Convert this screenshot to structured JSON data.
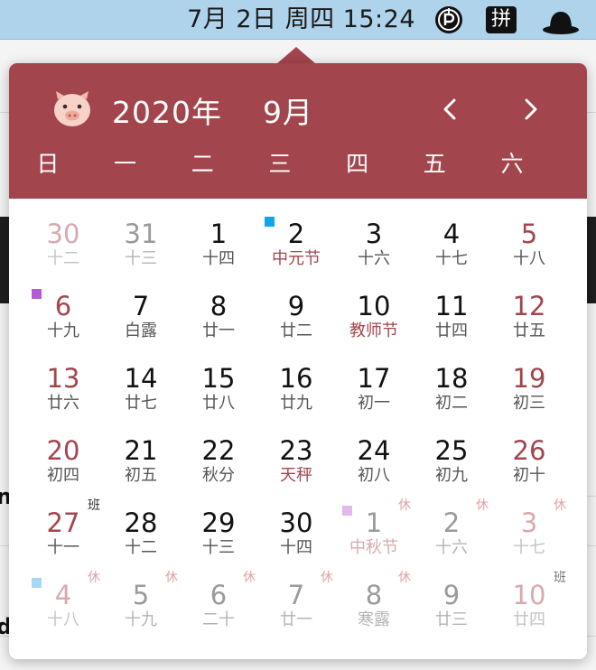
{
  "menubar": {
    "clock": "7月 2日 周四 15:24",
    "input_method_label": "拼",
    "icons": [
      "parking-icon",
      "input-method-icon",
      "hat-icon"
    ]
  },
  "background_fragments": [
    "nt",
    "d"
  ],
  "calendar": {
    "title_year": "2020年",
    "title_month": "9月",
    "icons": {
      "mascot": "pig-face-icon",
      "prev": "chevron-left-icon",
      "next": "chevron-right-icon"
    },
    "weekdays": [
      "日",
      "一",
      "二",
      "三",
      "四",
      "五",
      "六"
    ],
    "accent_color": "#a3454d",
    "days": [
      {
        "day": "30",
        "lunar": "十二",
        "muted": true,
        "weekend": true
      },
      {
        "day": "31",
        "lunar": "十三",
        "muted": true
      },
      {
        "day": "1",
        "lunar": "十四"
      },
      {
        "day": "2",
        "lunar": "中元节",
        "festival": true,
        "marker": "#0ea5e9"
      },
      {
        "day": "3",
        "lunar": "十六"
      },
      {
        "day": "4",
        "lunar": "十七"
      },
      {
        "day": "5",
        "lunar": "十八",
        "weekend": true
      },
      {
        "day": "6",
        "lunar": "十九",
        "weekend": true,
        "marker": "#b25bd6"
      },
      {
        "day": "7",
        "lunar": "白露"
      },
      {
        "day": "8",
        "lunar": "廿一"
      },
      {
        "day": "9",
        "lunar": "廿二"
      },
      {
        "day": "10",
        "lunar": "教师节",
        "festival": true
      },
      {
        "day": "11",
        "lunar": "廿四"
      },
      {
        "day": "12",
        "lunar": "廿五",
        "weekend": true
      },
      {
        "day": "13",
        "lunar": "廿六",
        "weekend": true
      },
      {
        "day": "14",
        "lunar": "廿七"
      },
      {
        "day": "15",
        "lunar": "廿八"
      },
      {
        "day": "16",
        "lunar": "廿九"
      },
      {
        "day": "17",
        "lunar": "初一"
      },
      {
        "day": "18",
        "lunar": "初二"
      },
      {
        "day": "19",
        "lunar": "初三",
        "weekend": true
      },
      {
        "day": "20",
        "lunar": "初四",
        "weekend": true
      },
      {
        "day": "21",
        "lunar": "初五"
      },
      {
        "day": "22",
        "lunar": "秋分"
      },
      {
        "day": "23",
        "lunar": "天秤",
        "festival": true
      },
      {
        "day": "24",
        "lunar": "初八"
      },
      {
        "day": "25",
        "lunar": "初九"
      },
      {
        "day": "26",
        "lunar": "初十",
        "weekend": true
      },
      {
        "day": "27",
        "lunar": "十一",
        "weekend": true,
        "badge": "班",
        "badge_type": "work"
      },
      {
        "day": "28",
        "lunar": "十二"
      },
      {
        "day": "29",
        "lunar": "十三"
      },
      {
        "day": "30",
        "lunar": "十四"
      },
      {
        "day": "1",
        "lunar": "中秋节",
        "muted": true,
        "festival": true,
        "badge": "休",
        "badge_type": "rest",
        "marker": "#e3b8ea"
      },
      {
        "day": "2",
        "lunar": "十六",
        "muted": true,
        "badge": "休",
        "badge_type": "rest"
      },
      {
        "day": "3",
        "lunar": "十七",
        "muted": true,
        "weekend": true,
        "badge": "休",
        "badge_type": "rest"
      },
      {
        "day": "4",
        "lunar": "十八",
        "muted": true,
        "weekend": true,
        "badge": "休",
        "badge_type": "rest",
        "marker": "#a5d8f5"
      },
      {
        "day": "5",
        "lunar": "十九",
        "muted": true,
        "badge": "休",
        "badge_type": "rest"
      },
      {
        "day": "6",
        "lunar": "二十",
        "muted": true,
        "badge": "休",
        "badge_type": "rest"
      },
      {
        "day": "7",
        "lunar": "廿一",
        "muted": true,
        "badge": "休",
        "badge_type": "rest"
      },
      {
        "day": "8",
        "lunar": "寒露",
        "muted": true,
        "badge": "休",
        "badge_type": "rest"
      },
      {
        "day": "9",
        "lunar": "廿三",
        "muted": true
      },
      {
        "day": "10",
        "lunar": "廿四",
        "muted": true,
        "weekend": true,
        "badge": "班",
        "badge_type": "work"
      }
    ]
  }
}
